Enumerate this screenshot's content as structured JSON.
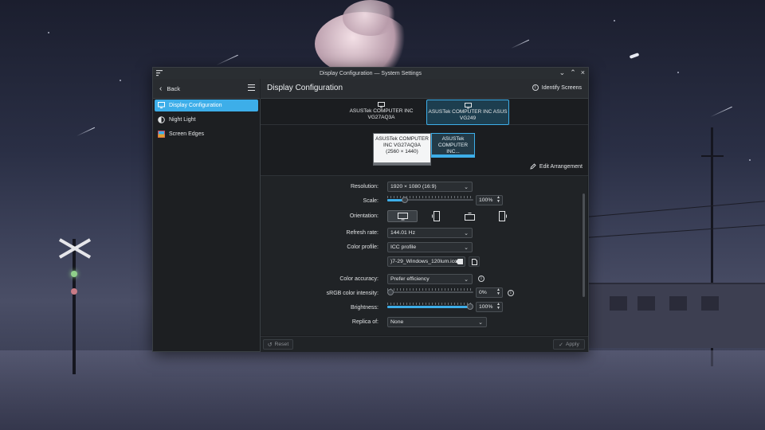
{
  "window": {
    "title": "Display Configuration — System Settings"
  },
  "sidebar": {
    "back_label": "Back",
    "items": [
      {
        "label": "Display Configuration",
        "icon": "monitor-icon",
        "active": true
      },
      {
        "label": "Night Light",
        "icon": "night-light-icon",
        "active": false
      },
      {
        "label": "Screen Edges",
        "icon": "screen-edges-icon",
        "active": false
      }
    ]
  },
  "header": {
    "title": "Display Configuration",
    "identify_label": "Identify Screens"
  },
  "outputs": [
    {
      "line1": "ASUSTek COMPUTER INC",
      "line2": "VG27AQ3A",
      "selected": false
    },
    {
      "line1": "ASUSTek COMPUTER INC ASUS",
      "line2": "VG249",
      "selected": true
    }
  ],
  "arrangement": {
    "monitor1": {
      "line1": "ASUSTek COMPUTER",
      "line2": "INC VG27AQ3A",
      "line3": "(2560 × 1440)"
    },
    "monitor2": {
      "line1": "ASUSTek",
      "line2": "COMPUTER INC..."
    },
    "edit_label": "Edit Arrangement"
  },
  "form": {
    "resolution": {
      "label": "Resolution:",
      "value": "1920 × 1080 (16:9)"
    },
    "scale": {
      "label": "Scale:",
      "value": "100%",
      "level": 0.18
    },
    "orientation": {
      "label": "Orientation:",
      "selected_index": 0
    },
    "refresh_rate": {
      "label": "Refresh rate:",
      "value": "144.01 Hz"
    },
    "color_profile": {
      "label": "Color profile:",
      "value": "ICC profile",
      "file": ")7-29_Windows_120lum.icc"
    },
    "color_accuracy": {
      "label": "Color accuracy:",
      "value": "Prefer efficiency"
    },
    "srgb_intensity": {
      "label": "sRGB color intensity:",
      "value": "0%",
      "level": 0.0
    },
    "brightness": {
      "label": "Brightness:",
      "value": "100%",
      "level": 1.0
    },
    "replica_of": {
      "label": "Replica of:",
      "value": "None"
    }
  },
  "footer": {
    "reset_label": "Reset",
    "apply_label": "Apply"
  },
  "colors": {
    "accent": "#3daee9",
    "window_bg": "#202326",
    "selection_bg": "#1d3e4f"
  }
}
